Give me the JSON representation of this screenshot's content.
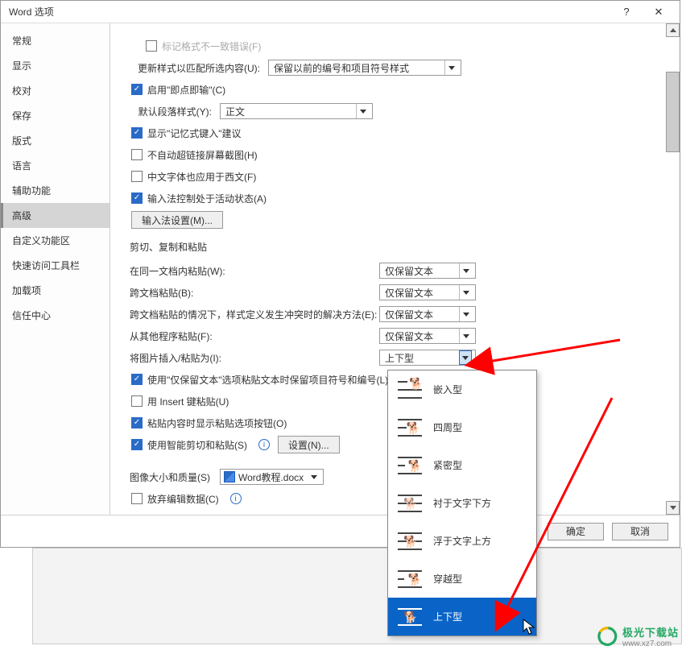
{
  "title": "Word 选项",
  "sidebar": {
    "items": [
      {
        "label": "常规"
      },
      {
        "label": "显示"
      },
      {
        "label": "校对"
      },
      {
        "label": "保存"
      },
      {
        "label": "版式"
      },
      {
        "label": "语言"
      },
      {
        "label": "辅助功能"
      },
      {
        "label": "高级",
        "selected": true
      },
      {
        "label": "自定义功能区"
      },
      {
        "label": "快速访问工具栏"
      },
      {
        "label": "加载项"
      },
      {
        "label": "信任中心"
      }
    ]
  },
  "editing": {
    "mark_format_inconsistency": "标记格式不一致错误(F)",
    "update_style_label": "更新样式以匹配所选内容(U):",
    "update_style_value": "保留以前的编号和项目符号样式",
    "click_and_type": "启用\"即点即输\"(C)",
    "default_paragraph_label": "默认段落样式(Y):",
    "default_paragraph_value": "正文",
    "show_autocomplete": "显示\"记忆式键入\"建议",
    "no_hyperlink_screenshot": "不自动超链接屏幕截图(H)",
    "cjk_west": "中文字体也应用于西文(F)",
    "ime_active": "输入法控制处于活动状态(A)",
    "ime_settings_btn": "输入法设置(M)..."
  },
  "paste_section_title": "剪切、复制和粘贴",
  "paste": {
    "same_doc_label": "在同一文档内粘贴(W):",
    "same_doc_value": "仅保留文本",
    "cross_doc_label": "跨文档粘贴(B):",
    "cross_doc_value": "仅保留文本",
    "conflict_label": "跨文档粘贴的情况下，样式定义发生冲突时的解决方法(E):",
    "conflict_value": "仅保留文本",
    "other_prog_label": "从其他程序粘贴(F):",
    "other_prog_value": "仅保留文本",
    "insert_picture_label": "将图片插入/粘贴为(I):",
    "insert_picture_value": "上下型",
    "keep_bullets": "使用\"仅保留文本\"选项粘贴文本时保留项目符号和编号(L)",
    "insert_key": "用 Insert 键粘贴(U)",
    "show_paste_options": "粘贴内容时显示粘贴选项按钮(O)",
    "smart_cut_paste": "使用智能剪切和粘贴(S)",
    "settings_btn": "设置(N)..."
  },
  "image_section": {
    "title": "图像大小和质量(S)",
    "doc_name": "Word教程.docx",
    "discard_edit": "放弃编辑数据(C)"
  },
  "dropdown": {
    "items": [
      {
        "label": "嵌入型",
        "wrap": "inline"
      },
      {
        "label": "四周型",
        "wrap": "square"
      },
      {
        "label": "紧密型",
        "wrap": "tight"
      },
      {
        "label": "衬于文字下方",
        "wrap": "behind"
      },
      {
        "label": "浮于文字上方",
        "wrap": "front"
      },
      {
        "label": "穿越型",
        "wrap": "through"
      },
      {
        "label": "上下型",
        "wrap": "topbot",
        "selected": true
      }
    ]
  },
  "footer": {
    "ok": "确定",
    "cancel": "取消"
  },
  "watermark": {
    "brand": "极光下载站",
    "url": "www.xz7.com"
  }
}
